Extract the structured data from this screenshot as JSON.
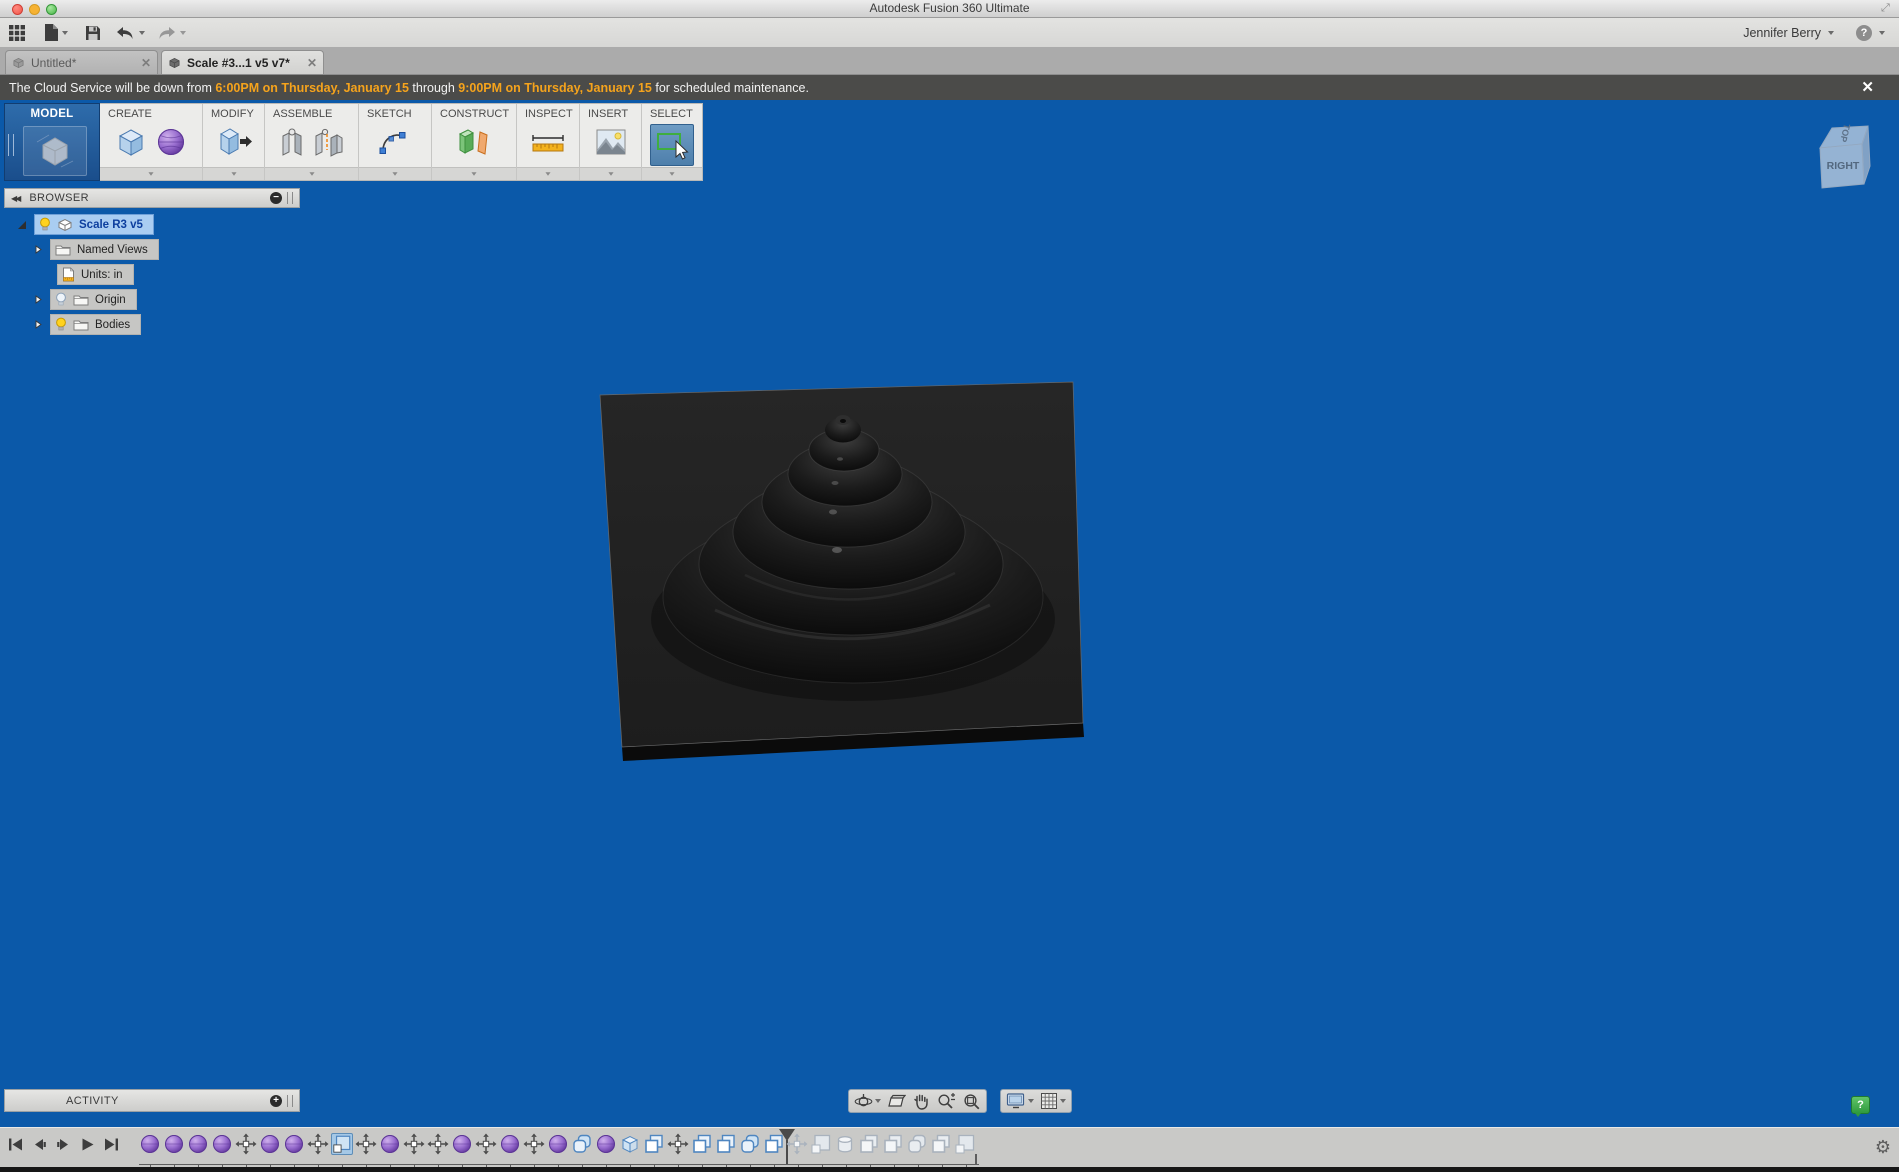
{
  "titlebar": {
    "title": "Autodesk Fusion 360 Ultimate"
  },
  "toolbar": {
    "user": "Jennifer Berry"
  },
  "tabs": [
    {
      "label": "Untitled*",
      "active": false,
      "close": "✕"
    },
    {
      "label": "Scale #3...1 v5 v7*",
      "active": true,
      "close": "✕"
    }
  ],
  "banner": {
    "segments": [
      {
        "text": "The Cloud Service will be down from ",
        "highlight": false
      },
      {
        "text": "6:00PM on Thursday, January 15",
        "highlight": true
      },
      {
        "text": " through ",
        "highlight": false
      },
      {
        "text": "9:00PM on Thursday, January 15",
        "highlight": true
      },
      {
        "text": " for scheduled maintenance.",
        "highlight": false
      }
    ],
    "close": "✕"
  },
  "ribbon": {
    "model_tab": "MODEL",
    "groups": [
      {
        "label": "CREATE",
        "icons": [
          "box-icon",
          "sphere-icon"
        ]
      },
      {
        "label": "MODIFY",
        "icons": [
          "press-pull-icon"
        ]
      },
      {
        "label": "ASSEMBLE",
        "icons": [
          "joint-icon",
          "as-built-joint-icon"
        ]
      },
      {
        "label": "SKETCH",
        "icons": [
          "spline-icon"
        ]
      },
      {
        "label": "CONSTRUCT",
        "icons": [
          "construct-plane-icon"
        ]
      },
      {
        "label": "INSPECT",
        "icons": [
          "measure-icon"
        ]
      },
      {
        "label": "INSERT",
        "icons": [
          "insert-image-icon"
        ]
      },
      {
        "label": "SELECT",
        "icons": [
          "select-icon"
        ],
        "selected": true
      }
    ]
  },
  "browser": {
    "title": "BROWSER",
    "rows": [
      {
        "label": "Scale R3 v5",
        "selected": true,
        "icons": [
          "expand-triangle",
          "bulb-on",
          "component-cube"
        ]
      },
      {
        "label": "Named Views",
        "selected": false,
        "icons": [
          "collapse-triangle",
          "folder"
        ]
      },
      {
        "label": "Units: in",
        "selected": false,
        "icons": [
          "units-document"
        ]
      },
      {
        "label": "Origin",
        "selected": false,
        "icons": [
          "collapse-triangle",
          "bulb-off",
          "folder"
        ]
      },
      {
        "label": "Bodies",
        "selected": false,
        "icons": [
          "collapse-triangle",
          "bulb-on",
          "folder"
        ]
      }
    ]
  },
  "viewcube": {
    "front": "RIGHT",
    "top": "TOP"
  },
  "activity": {
    "label": "ACTIVITY"
  },
  "timeline": {
    "items_before_marker": [
      "form",
      "form",
      "form",
      "form",
      "move",
      "form",
      "form",
      "move",
      "scale-selected",
      "move",
      "form",
      "move",
      "move",
      "form",
      "move",
      "form",
      "move",
      "form",
      "fillet",
      "form",
      "box",
      "combine",
      "move",
      "combine",
      "combine",
      "fillet",
      "combine"
    ],
    "items_after_marker": [
      "move",
      "scale",
      "cylinder",
      "combine",
      "combine",
      "fillet",
      "combine",
      "scale"
    ]
  },
  "colors": {
    "viewport_blue": "#0b59a9",
    "banner_highlight": "#f5a31c",
    "model_tab_blue": "#1f5796",
    "selection_blue": "#a9cdf2",
    "timeline_form_purple": "#9a6fd0"
  }
}
